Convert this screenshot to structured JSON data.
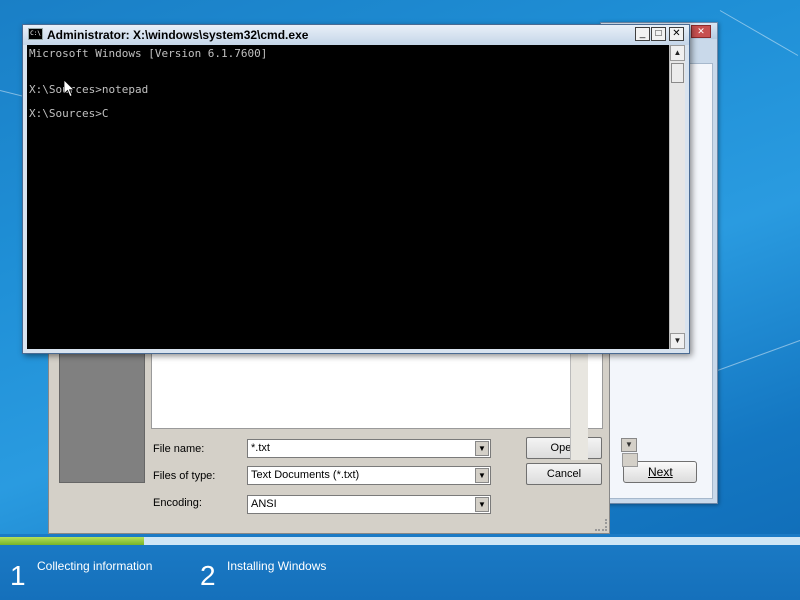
{
  "cmd": {
    "title": "Administrator: X:\\windows\\system32\\cmd.exe",
    "icon_text": "C:\\",
    "buttons": {
      "minimize": "_",
      "maximize": "□",
      "close": "✕"
    },
    "lines": [
      "Microsoft Windows [Version 6.1.7600]",
      "",
      "X:\\Sources>notepad",
      "",
      "X:\\Sources>C"
    ]
  },
  "open_dialog": {
    "file_name_label": "File name:",
    "file_name_value": "*.txt",
    "files_of_type_label": "Files of type:",
    "files_of_type_value": "Text Documents (*.txt)",
    "encoding_label": "Encoding:",
    "encoding_value": "ANSI",
    "open_label": "Open",
    "cancel_label": "Cancel"
  },
  "setup": {
    "next_label": "Next"
  },
  "progress": {
    "fraction": 0.18,
    "steps": [
      {
        "number": "1",
        "label": "Collecting information"
      },
      {
        "number": "2",
        "label": "Installing Windows"
      }
    ]
  },
  "icons": {
    "combo_arrow": "▼",
    "scroll_up": "▲",
    "scroll_down": "▼"
  },
  "colors": {
    "console_bg": "#000000",
    "console_text": "#c0c0c0",
    "progress_fill": "#8cc63f",
    "desktop": "#1f8fd6"
  }
}
